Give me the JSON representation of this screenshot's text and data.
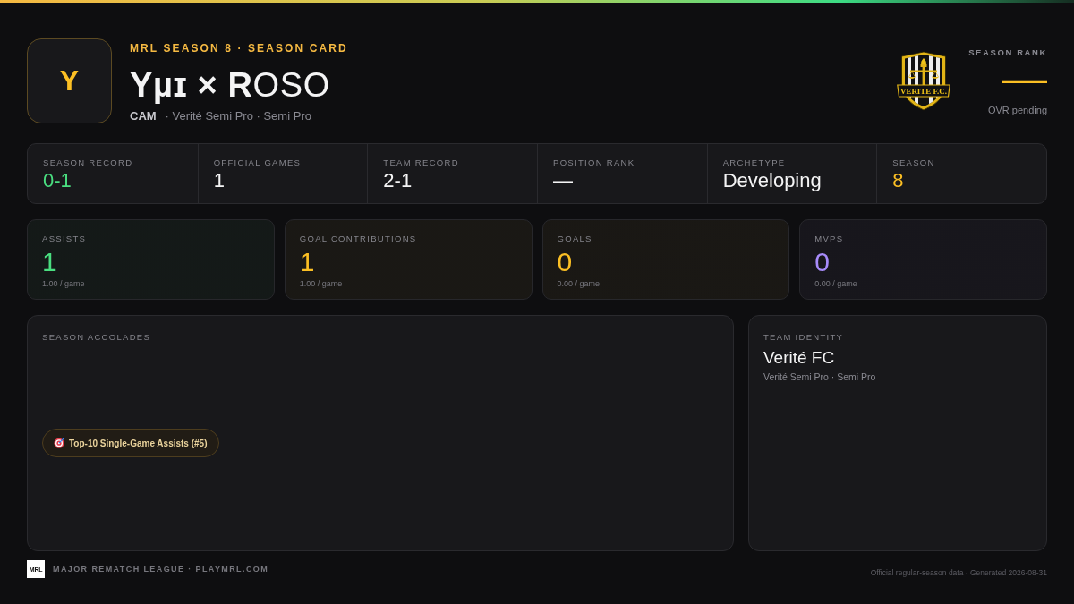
{
  "header": {
    "avatar_initial": "Y",
    "eyebrow": "MRL SEASON 8 · SEASON CARD",
    "player_name": "**Yµɪ × R**OSO",
    "position": "CAM",
    "affiliation": "· Verité Semi Pro · Semi Pro",
    "crest_text": "VERITE F.C.",
    "rank_label": "SEASON RANK",
    "rank_value": "—",
    "rank_note": "OVR pending"
  },
  "stats": [
    {
      "label": "SEASON RECORD",
      "value": "0-1",
      "color": "#4ade80"
    },
    {
      "label": "OFFICIAL GAMES",
      "value": "1",
      "color": "#f4f4f5"
    },
    {
      "label": "TEAM RECORD",
      "value": "2-1",
      "color": "#f4f4f5"
    },
    {
      "label": "POSITION RANK",
      "value": "—",
      "color": "#f4f4f5"
    },
    {
      "label": "ARCHETYPE",
      "value": "Developing",
      "color": "#f4f4f5"
    },
    {
      "label": "SEASON",
      "value": "8",
      "color": "#fbbf24"
    }
  ],
  "metrics": [
    {
      "label": "ASSISTS",
      "value": "1",
      "rate": "1.00 / game",
      "color": "#4ade80"
    },
    {
      "label": "GOAL CONTRIBUTIONS",
      "value": "1",
      "rate": "1.00 / game",
      "color": "#fbbf24"
    },
    {
      "label": "GOALS",
      "value": "0",
      "rate": "0.00 / game",
      "color": "#fbbf24"
    },
    {
      "label": "MVPS",
      "value": "0",
      "rate": "0.00 / game",
      "color": "#a78bfa"
    }
  ],
  "accolades": {
    "title": "SEASON ACCOLADES",
    "items": [
      {
        "label": "Top-10 Single-Game Assists (#5)"
      }
    ]
  },
  "team_identity": {
    "title": "TEAM IDENTITY",
    "name": "Verité FC",
    "division": "Verité Semi Pro · Semi Pro"
  },
  "footer": {
    "logo_text": "MRL",
    "league": "MAJOR REMATCH LEAGUE · PLAYMRL.COM",
    "note": "Official regular-season data · Generated 2026-08-31"
  }
}
